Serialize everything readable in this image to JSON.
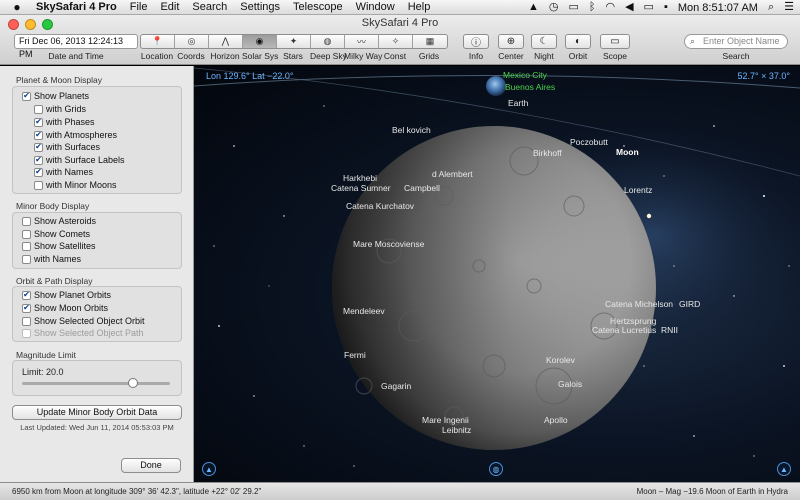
{
  "menubar": {
    "app_name": "SkySafari 4 Pro",
    "items": [
      "File",
      "Edit",
      "Search",
      "Settings",
      "Telescope",
      "Window",
      "Help"
    ],
    "status": {
      "clock": "Mon 8:51:07 AM"
    }
  },
  "window": {
    "title": "SkySafari 4 Pro"
  },
  "toolbar": {
    "date_value": "Fri Dec 06, 2013  12:24:13 PM",
    "date_caption": "Date and Time",
    "segments": [
      {
        "label": "Location",
        "icon": "pin-icon",
        "glyph": "📍"
      },
      {
        "label": "Coords",
        "icon": "coords-icon",
        "glyph": "◎"
      },
      {
        "label": "Horizon",
        "icon": "horizon-icon",
        "glyph": "⋀"
      },
      {
        "label": "Solar Sys",
        "icon": "solar-system-icon",
        "glyph": "◉"
      },
      {
        "label": "Stars",
        "icon": "stars-icon",
        "glyph": "✦"
      },
      {
        "label": "Deep Sky",
        "icon": "deep-sky-icon",
        "glyph": "◍"
      },
      {
        "label": "Milky Way",
        "icon": "milky-way-icon",
        "glyph": "〰"
      },
      {
        "label": "Const",
        "icon": "constellation-icon",
        "glyph": "✧"
      },
      {
        "label": "Grids",
        "icon": "grid-icon",
        "glyph": "▦"
      }
    ],
    "info_label": "Info",
    "center_label": "Center",
    "night_label": "Night",
    "orbit_label": "Orbit",
    "scope_label": "Scope",
    "search_placeholder": "Enter Object Name",
    "search_caption": "Search"
  },
  "sidebar": {
    "planet_moon": {
      "title": "Planet & Moon Display",
      "items": [
        {
          "label": "Show Planets",
          "checked": "✔"
        },
        {
          "label": "with Grids",
          "checked": ""
        },
        {
          "label": "with Phases",
          "checked": "✔"
        },
        {
          "label": "with Atmospheres",
          "checked": "✔"
        },
        {
          "label": "with Surfaces",
          "checked": "✔"
        },
        {
          "label": "with Surface Labels",
          "checked": "✔"
        },
        {
          "label": "with Names",
          "checked": "✔"
        },
        {
          "label": "with Minor Moons",
          "checked": ""
        }
      ]
    },
    "minor_body": {
      "title": "Minor Body Display",
      "items": [
        {
          "label": "Show Asteroids",
          "checked": ""
        },
        {
          "label": "Show Comets",
          "checked": ""
        },
        {
          "label": "Show Satellites",
          "checked": ""
        },
        {
          "label": "with Names",
          "checked": ""
        }
      ]
    },
    "orbit_path": {
      "title": "Orbit & Path Display",
      "items": [
        {
          "label": "Show Planet Orbits",
          "checked": "✔"
        },
        {
          "label": "Show Moon Orbits",
          "checked": "✔"
        },
        {
          "label": "Show Selected Object Orbit",
          "checked": ""
        },
        {
          "label": "Show Selected Object Path",
          "checked": ""
        }
      ]
    },
    "magnitude": {
      "title": "Magnitude Limit",
      "limit_text": "Limit:  20.0",
      "slider_fraction": 0.77
    },
    "update_button": "Update Minor Body Orbit Data",
    "last_updated": "Last Updated: Wed Jun 11, 2014  05:53:03 PM",
    "done_button": "Done"
  },
  "sky": {
    "coords_left": "Lon 129.6°  Lat −22.0°",
    "fov_right": "52.7° × 37.0°",
    "earth_labels": {
      "city1": "Mexico City",
      "city2": "Buenos Aires",
      "earth": "Earth"
    },
    "moon_label": "Moon",
    "features": [
      "Bel kovich",
      "Poczobutt",
      "Birkhoff",
      "Harkhebi",
      "d Alembert",
      "Catena Sumner",
      "Campbell",
      "Catena Kurchatov",
      "Lorentz",
      "Mare Moscoviense",
      "Mendeleev",
      "Catena Michelson",
      "GIRD",
      "Hertzsprung",
      "Catena Lucretius",
      "RNII",
      "Fermi",
      "Korolev",
      "Gagarin",
      "Galois",
      "Mare Ingenii",
      "Apollo",
      "Leibnitz"
    ]
  },
  "status": {
    "left": "6950 km from Moon at longitude 309° 36' 42.3\", latitude +22° 02' 29.2\"",
    "right": "Moon – Mag −19.6 Moon of Earth in Hydra"
  },
  "colors": {
    "sky_label_green": "#4dd24d",
    "sky_coord_blue": "#6fb6ff",
    "check_blue": "#0a3d8f"
  }
}
